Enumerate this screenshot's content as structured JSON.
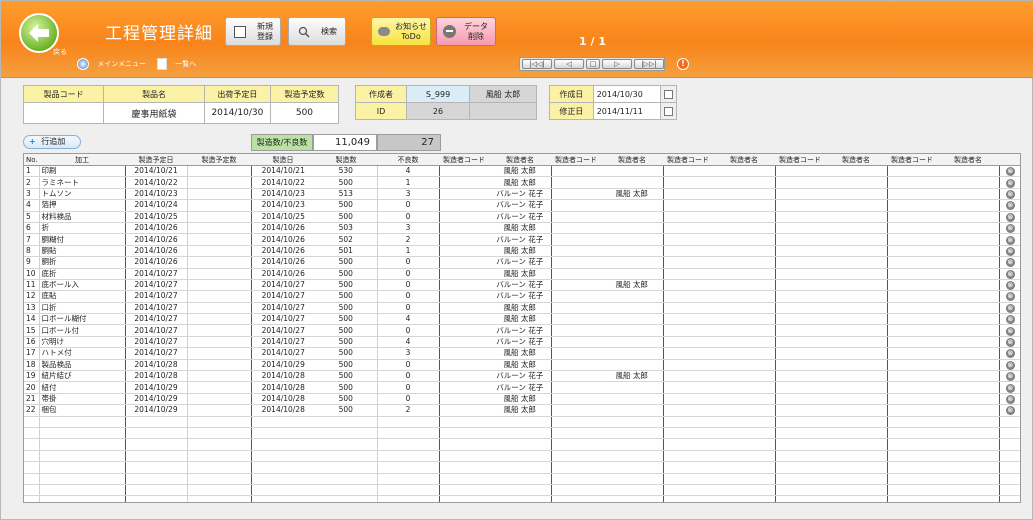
{
  "header": {
    "back_label": "戻る",
    "title": "工程管理詳細",
    "new_label_1": "新規",
    "new_label_2": "登録",
    "search_label": "検索",
    "todo_label_1": "お知らせ",
    "todo_label_2": "ToDo",
    "delete_label_1": "データ",
    "delete_label_2": "削除",
    "page_counter": "1 / 1",
    "main_menu_label": "メインメニュー",
    "list_label": "一覧へ",
    "nav_first": "|◁◁|",
    "nav_prev": "◁",
    "nav_stop": "□",
    "nav_next": "▷",
    "nav_last": "|▷▷|",
    "info_icon": "!"
  },
  "product_info": {
    "col1": "製品コード",
    "col2": "製品名",
    "col3": "出荷予定日",
    "col4": "製造予定数",
    "code": "",
    "name": "慶事用紙袋",
    "ship_date": "2014/10/30",
    "planned_qty": "500"
  },
  "creator_info": {
    "creator_label": "作成者",
    "creator_code": "S_999",
    "creator_name": "風船 太郎",
    "id_label": "ID",
    "id_value": "26"
  },
  "dates_info": {
    "created_label": "作成日",
    "created_value": "2014/10/30",
    "modified_label": "修正日",
    "modified_value": "2014/11/11"
  },
  "summary": {
    "add_row_label": "行追加",
    "label": "製造数/不良数",
    "production_total": "11,049",
    "defect_total": "27"
  },
  "table": {
    "headers": [
      "No.",
      "加工",
      "製造予定日",
      "製造予定数",
      "製造日",
      "製造数",
      "不良数",
      "製造者コード",
      "製造者名",
      "製造者コード",
      "製造者名",
      "製造者コード",
      "製造者名",
      "製造者コード",
      "製造者名",
      "製造者コード",
      "製造者名"
    ],
    "rows": [
      {
        "no": "1",
        "process": "印刷",
        "planned_date": "2014/10/21",
        "planned_qty": "",
        "date": "2014/10/21",
        "qty": "530",
        "defect": "4",
        "maker1": "風船 太郎",
        "maker2": ""
      },
      {
        "no": "2",
        "process": "ラミネート",
        "planned_date": "2014/10/22",
        "planned_qty": "",
        "date": "2014/10/22",
        "qty": "500",
        "defect": "1",
        "maker1": "風船 太郎",
        "maker2": ""
      },
      {
        "no": "3",
        "process": "トムソン",
        "planned_date": "2014/10/23",
        "planned_qty": "",
        "date": "2014/10/23",
        "qty": "513",
        "defect": "3",
        "maker1": "バルーン 花子",
        "maker2": "風船 太郎"
      },
      {
        "no": "4",
        "process": "箔押",
        "planned_date": "2014/10/24",
        "planned_qty": "",
        "date": "2014/10/23",
        "qty": "500",
        "defect": "0",
        "maker1": "バルーン 花子",
        "maker2": ""
      },
      {
        "no": "5",
        "process": "材料検品",
        "planned_date": "2014/10/25",
        "planned_qty": "",
        "date": "2014/10/25",
        "qty": "500",
        "defect": "0",
        "maker1": "バルーン 花子",
        "maker2": ""
      },
      {
        "no": "6",
        "process": "折",
        "planned_date": "2014/10/26",
        "planned_qty": "",
        "date": "2014/10/26",
        "qty": "503",
        "defect": "3",
        "maker1": "風船 太郎",
        "maker2": ""
      },
      {
        "no": "7",
        "process": "胴糊付",
        "planned_date": "2014/10/26",
        "planned_qty": "",
        "date": "2014/10/26",
        "qty": "502",
        "defect": "2",
        "maker1": "バルーン 花子",
        "maker2": ""
      },
      {
        "no": "8",
        "process": "胴貼",
        "planned_date": "2014/10/26",
        "planned_qty": "",
        "date": "2014/10/26",
        "qty": "501",
        "defect": "1",
        "maker1": "風船 太郎",
        "maker2": ""
      },
      {
        "no": "9",
        "process": "胴折",
        "planned_date": "2014/10/26",
        "planned_qty": "",
        "date": "2014/10/26",
        "qty": "500",
        "defect": "0",
        "maker1": "バルーン 花子",
        "maker2": ""
      },
      {
        "no": "10",
        "process": "底折",
        "planned_date": "2014/10/27",
        "planned_qty": "",
        "date": "2014/10/26",
        "qty": "500",
        "defect": "0",
        "maker1": "風船 太郎",
        "maker2": ""
      },
      {
        "no": "11",
        "process": "底ボール入",
        "planned_date": "2014/10/27",
        "planned_qty": "",
        "date": "2014/10/27",
        "qty": "500",
        "defect": "0",
        "maker1": "バルーン 花子",
        "maker2": "風船 太郎"
      },
      {
        "no": "12",
        "process": "底貼",
        "planned_date": "2014/10/27",
        "planned_qty": "",
        "date": "2014/10/27",
        "qty": "500",
        "defect": "0",
        "maker1": "バルーン 花子",
        "maker2": ""
      },
      {
        "no": "13",
        "process": "口折",
        "planned_date": "2014/10/27",
        "planned_qty": "",
        "date": "2014/10/27",
        "qty": "500",
        "defect": "0",
        "maker1": "風船 太郎",
        "maker2": ""
      },
      {
        "no": "14",
        "process": "口ボール糊付",
        "planned_date": "2014/10/27",
        "planned_qty": "",
        "date": "2014/10/27",
        "qty": "500",
        "defect": "4",
        "maker1": "風船 太郎",
        "maker2": ""
      },
      {
        "no": "15",
        "process": "口ボール付",
        "planned_date": "2014/10/27",
        "planned_qty": "",
        "date": "2014/10/27",
        "qty": "500",
        "defect": "0",
        "maker1": "バルーン 花子",
        "maker2": ""
      },
      {
        "no": "16",
        "process": "穴明け",
        "planned_date": "2014/10/27",
        "planned_qty": "",
        "date": "2014/10/27",
        "qty": "500",
        "defect": "4",
        "maker1": "バルーン 花子",
        "maker2": ""
      },
      {
        "no": "17",
        "process": "ハトメ付",
        "planned_date": "2014/10/27",
        "planned_qty": "",
        "date": "2014/10/27",
        "qty": "500",
        "defect": "3",
        "maker1": "風船 太郎",
        "maker2": ""
      },
      {
        "no": "18",
        "process": "製品検品",
        "planned_date": "2014/10/28",
        "planned_qty": "",
        "date": "2014/10/29",
        "qty": "500",
        "defect": "0",
        "maker1": "風船 太郎",
        "maker2": ""
      },
      {
        "no": "19",
        "process": "紐片結び",
        "planned_date": "2014/10/28",
        "planned_qty": "",
        "date": "2014/10/28",
        "qty": "500",
        "defect": "0",
        "maker1": "バルーン 花子",
        "maker2": "風船 太郎"
      },
      {
        "no": "20",
        "process": "紐付",
        "planned_date": "2014/10/29",
        "planned_qty": "",
        "date": "2014/10/28",
        "qty": "500",
        "defect": "0",
        "maker1": "バルーン 花子",
        "maker2": ""
      },
      {
        "no": "21",
        "process": "帯掛",
        "planned_date": "2014/10/29",
        "planned_qty": "",
        "date": "2014/10/28",
        "qty": "500",
        "defect": "0",
        "maker1": "風船 太郎",
        "maker2": ""
      },
      {
        "no": "22",
        "process": "梱包",
        "planned_date": "2014/10/29",
        "planned_qty": "",
        "date": "2014/10/28",
        "qty": "500",
        "defect": "2",
        "maker1": "風船 太郎",
        "maker2": ""
      }
    ],
    "delete_icon": "⊗"
  },
  "colors": {
    "header_orange": "#f8841a",
    "label_yellow": "#fbf2a6",
    "value_blue": "#d9edf7",
    "summary_green": "#b9e2a3"
  }
}
